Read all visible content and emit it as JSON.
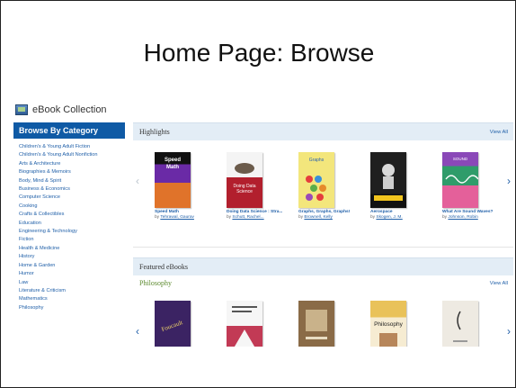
{
  "slide": {
    "title": "Home Page: Browse"
  },
  "collection": {
    "title": "eBook Collection"
  },
  "sidebar": {
    "heading": "Browse By Category",
    "categories": [
      "Children's & Young Adult Fiction",
      "Children's & Young Adult Nonfiction",
      "Arts & Architecture",
      "Biographies & Memoirs",
      "Body, Mind & Spirit",
      "Business & Economics",
      "Computer Science",
      "Cooking",
      "Crafts & Collectibles",
      "Education",
      "Engineering & Technology",
      "Fiction",
      "Health & Medicine",
      "History",
      "Home & Garden",
      "Humor",
      "Law",
      "Literature & Criticism",
      "Mathematics",
      "Philosophy"
    ]
  },
  "highlights": {
    "title": "Highlights",
    "view_all": "View All",
    "books": [
      {
        "title": "Speed Math",
        "by": "by",
        "author": "Tehrawal, Gaurav",
        "cover_color": "#1d1d1d"
      },
      {
        "title": "Doing Data Science : Stra...",
        "by": "by",
        "author": "Schutt, Rachel...",
        "cover_color": "#b21f2d"
      },
      {
        "title": "Graphs, Graphs, Graphs!",
        "by": "by",
        "author": "Brownell, Kelly",
        "cover_color": "#eadc52"
      },
      {
        "title": "Aerospace",
        "by": "by",
        "author": "Skogen, J. M.",
        "cover_color": "#2b2b2b"
      },
      {
        "title": "What Are Sound Waves?",
        "by": "by",
        "author": "Johnson, Robin",
        "cover_color": "#3b7f3a"
      }
    ]
  },
  "featured": {
    "title": "Featured eBooks",
    "view_all": "View All",
    "subcategory": "Philosophy",
    "books": [
      {
        "cover_color": "#3b2363"
      },
      {
        "cover_color": "#c23a55"
      },
      {
        "cover_color": "#8a6b47"
      },
      {
        "cover_color": "#e9c25a"
      },
      {
        "cover_color": "#eeeae2"
      }
    ]
  },
  "colors": {
    "brand_blue": "#0f5aa5",
    "link_blue": "#1f5fa8",
    "section_bg": "#e3edf6",
    "subcategory_green": "#5c8a2e"
  },
  "icons": {
    "prev": "‹",
    "next": "›"
  }
}
